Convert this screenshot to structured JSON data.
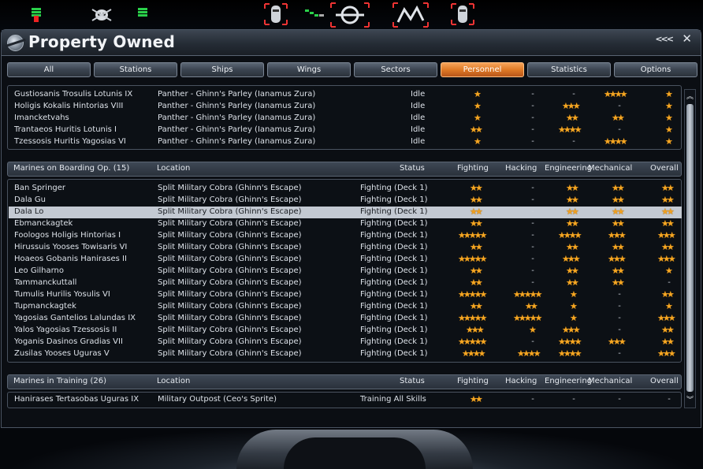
{
  "window": {
    "title": "Property Owned"
  },
  "hud": {
    "icons": [
      "status-bars-icon",
      "skull-ship-icon",
      "status-bars-icon",
      "robot-icon",
      "shield-bars-icon",
      "target-ship-icon",
      "missile-ship-icon",
      "robot-icon"
    ]
  },
  "tabs": [
    {
      "label": "All",
      "active": false
    },
    {
      "label": "Stations",
      "active": false
    },
    {
      "label": "Ships",
      "active": false
    },
    {
      "label": "Wings",
      "active": false
    },
    {
      "label": "Sectors",
      "active": false
    },
    {
      "label": "Personnel",
      "active": true
    },
    {
      "label": "Statistics",
      "active": false
    },
    {
      "label": "Options",
      "active": false
    }
  ],
  "top_list": {
    "rows": [
      {
        "name": "Gustiosanis Trosulis Lotunis IX",
        "location": "Panther - Ghinn's Parley (Ianamus Zura)",
        "status": "Idle",
        "fighting": 1,
        "hacking": 0,
        "engineering": 0,
        "mechanical": 4,
        "overall": 1
      },
      {
        "name": "Holigis Kokalis Hintorias VIII",
        "location": "Panther - Ghinn's Parley (Ianamus Zura)",
        "status": "Idle",
        "fighting": 1,
        "hacking": 0,
        "engineering": 3,
        "mechanical": 0,
        "overall": 1
      },
      {
        "name": "Imancketvahs",
        "location": "Panther - Ghinn's Parley (Ianamus Zura)",
        "status": "Idle",
        "fighting": 1,
        "hacking": 0,
        "engineering": 2,
        "mechanical": 2,
        "overall": 1
      },
      {
        "name": "Trantaeos Huritis Lotunis I",
        "location": "Panther - Ghinn's Parley (Ianamus Zura)",
        "status": "Idle",
        "fighting": 2,
        "hacking": 0,
        "engineering": 4,
        "mechanical": 0,
        "overall": 1
      },
      {
        "name": "Tzessosis Huritis Yagosias VI",
        "location": "Panther - Ghinn's Parley (Ianamus Zura)",
        "status": "Idle",
        "fighting": 1,
        "hacking": 0,
        "engineering": 0,
        "mechanical": 4,
        "overall": 1
      }
    ]
  },
  "boarding": {
    "header": {
      "title": "Marines on Boarding Op. (15)",
      "location": "Location",
      "status": "Status",
      "fighting": "Fighting",
      "hacking": "Hacking",
      "engineering": "Engineering",
      "mechanical": "Mechanical",
      "overall": "Overall"
    },
    "rows": [
      {
        "name": "Ban Springer",
        "location": "Split Military Cobra (Ghinn's Escape)",
        "status": "Fighting (Deck 1)",
        "fighting": 2,
        "hacking": 0,
        "engineering": 2,
        "mechanical": 2,
        "overall": 2,
        "selected": false
      },
      {
        "name": "Dala Gu",
        "location": "Split Military Cobra (Ghinn's Escape)",
        "status": "Fighting (Deck 1)",
        "fighting": 2,
        "hacking": 0,
        "engineering": 2,
        "mechanical": 2,
        "overall": 2,
        "selected": false
      },
      {
        "name": "Dala Lo",
        "location": "Split Military Cobra (Ghinn's Escape)",
        "status": "Fighting (Deck 1)",
        "fighting": 2,
        "hacking": 0,
        "engineering": 2,
        "mechanical": 2,
        "overall": 2,
        "selected": true
      },
      {
        "name": "Ebmanckagtek",
        "location": "Split Military Cobra (Ghinn's Escape)",
        "status": "Fighting (Deck 1)",
        "fighting": 2,
        "hacking": 0,
        "engineering": 2,
        "mechanical": 2,
        "overall": 2,
        "selected": false
      },
      {
        "name": "Foologos Holigis Hintorias I",
        "location": "Split Military Cobra (Ghinn's Escape)",
        "status": "Fighting (Deck 1)",
        "fighting": 5,
        "hacking": 0,
        "engineering": 4,
        "mechanical": 3,
        "overall": 3,
        "selected": false
      },
      {
        "name": "Hirussuis Yooses Towisaris VI",
        "location": "Split Military Cobra (Ghinn's Escape)",
        "status": "Fighting (Deck 1)",
        "fighting": 2,
        "hacking": 0,
        "engineering": 2,
        "mechanical": 2,
        "overall": 2,
        "selected": false
      },
      {
        "name": "Hoaeos Gobanis Hanirases II",
        "location": "Split Military Cobra (Ghinn's Escape)",
        "status": "Fighting (Deck 1)",
        "fighting": 5,
        "hacking": 0,
        "engineering": 3,
        "mechanical": 3,
        "overall": 3,
        "selected": false
      },
      {
        "name": "Leo Gilharno",
        "location": "Split Military Cobra (Ghinn's Escape)",
        "status": "Fighting (Deck 1)",
        "fighting": 2,
        "hacking": 0,
        "engineering": 2,
        "mechanical": 2,
        "overall": 1,
        "selected": false
      },
      {
        "name": "Tammanckuttall",
        "location": "Split Military Cobra (Ghinn's Escape)",
        "status": "Fighting (Deck 1)",
        "fighting": 2,
        "hacking": 0,
        "engineering": 2,
        "mechanical": 2,
        "overall": 0,
        "selected": false
      },
      {
        "name": "Tumulis Hurilis Yosulis VI",
        "location": "Split Military Cobra (Ghinn's Escape)",
        "status": "Fighting (Deck 1)",
        "fighting": 5,
        "hacking": 5,
        "engineering": 1,
        "mechanical": 0,
        "overall": 2,
        "selected": false
      },
      {
        "name": "Tupmanckagtek",
        "location": "Split Military Cobra (Ghinn's Escape)",
        "status": "Fighting (Deck 1)",
        "fighting": 2,
        "hacking": 2,
        "engineering": 1,
        "mechanical": 0,
        "overall": 1,
        "selected": false
      },
      {
        "name": "Yagosias Gantelios Lalundas IX",
        "location": "Split Military Cobra (Ghinn's Escape)",
        "status": "Fighting (Deck 1)",
        "fighting": 5,
        "hacking": 5,
        "engineering": 1,
        "mechanical": 0,
        "overall": 3,
        "selected": false
      },
      {
        "name": "Yalos Yagosias Tzessosis II",
        "location": "Split Military Cobra (Ghinn's Escape)",
        "status": "Fighting (Deck 1)",
        "fighting": 3,
        "hacking": 1,
        "engineering": 3,
        "mechanical": 0,
        "overall": 2,
        "selected": false
      },
      {
        "name": "Yoganis Dasinos Gradias VII",
        "location": "Split Military Cobra (Ghinn's Escape)",
        "status": "Fighting (Deck 1)",
        "fighting": 5,
        "hacking": 0,
        "engineering": 4,
        "mechanical": 3,
        "overall": 2,
        "selected": false
      },
      {
        "name": "Zusilas Yooses Uguras V",
        "location": "Split Military Cobra (Ghinn's Escape)",
        "status": "Fighting (Deck 1)",
        "fighting": 4,
        "hacking": 4,
        "engineering": 4,
        "mechanical": 0,
        "overall": 3,
        "selected": false
      }
    ]
  },
  "training": {
    "header": {
      "title": "Marines in Training (26)",
      "location": "Location",
      "status": "Status",
      "fighting": "Fighting",
      "hacking": "Hacking",
      "engineering": "Engineering",
      "mechanical": "Mechanical",
      "overall": "Overall"
    },
    "rows": [
      {
        "name": "Hanirases Tertasobas Uguras IX",
        "location": "Military Outpost (Ceo's Sprite)",
        "status": "Training All Skills",
        "fighting": 2,
        "hacking": 0,
        "engineering": 0,
        "mechanical": 0,
        "overall": 0
      }
    ]
  },
  "empty_marker": "-",
  "star_glyph": "★",
  "colors": {
    "accent": "#e07a26",
    "star": "#f5a623",
    "selected_row": "#c3c9d2"
  }
}
